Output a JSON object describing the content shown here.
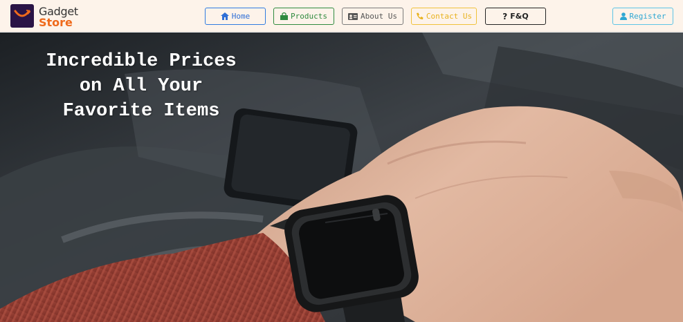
{
  "brand": {
    "line1": "Gadget",
    "line2": "Store",
    "colors": {
      "box": "#2a1446",
      "accent": "#ef6a1c"
    }
  },
  "nav": {
    "home": {
      "label": "Home",
      "icon": "home-icon"
    },
    "products": {
      "label": "Products",
      "icon": "shopping-bag-icon"
    },
    "about": {
      "label": "About Us",
      "icon": "id-card-icon"
    },
    "contact": {
      "label": "Contact Us",
      "icon": "phone-icon"
    },
    "faq": {
      "label": "F&Q",
      "icon": "question-icon"
    },
    "register": {
      "label": "Register",
      "icon": "user-icon"
    }
  },
  "hero": {
    "lines": [
      "Incredible Prices",
      "on All Your",
      "Favorite Items"
    ]
  }
}
